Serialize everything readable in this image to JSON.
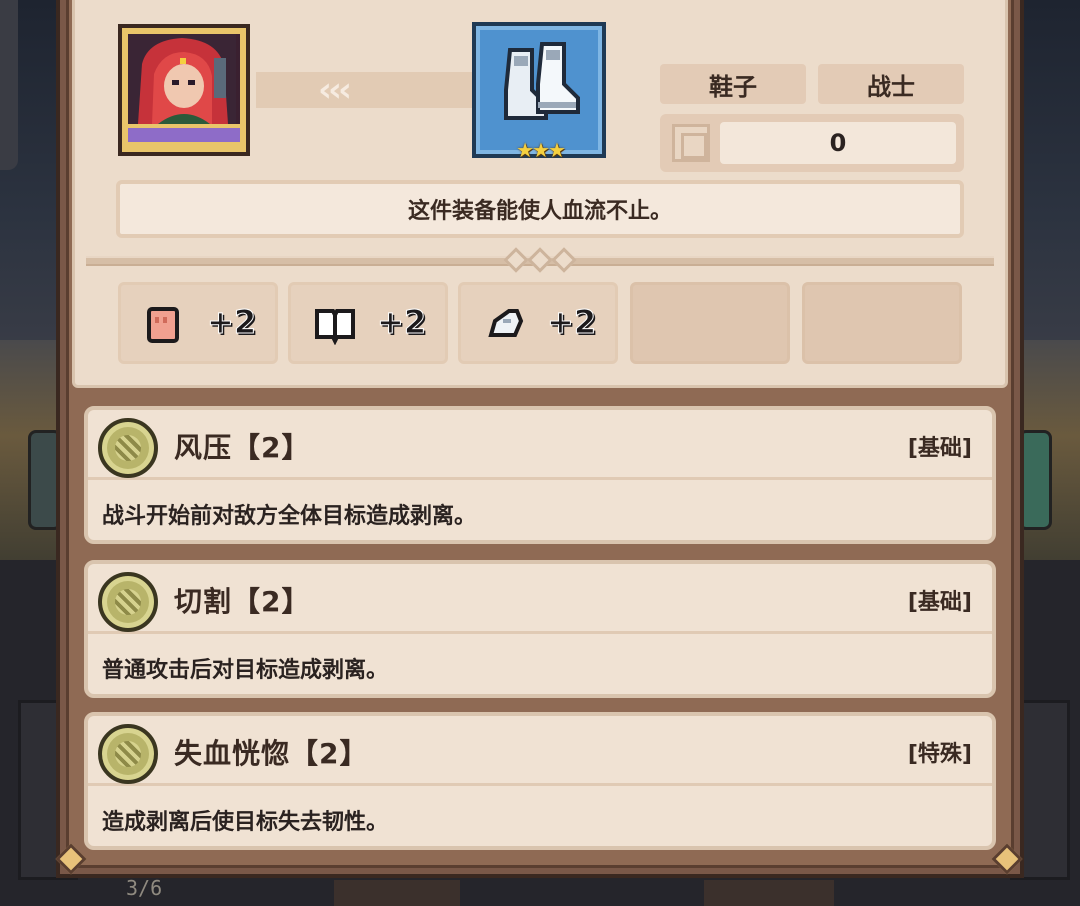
{
  "item": {
    "slot_tag": "鞋子",
    "class_tag": "战士",
    "value": "0",
    "stars": "★★★",
    "description": "这件装备能使人血流不止。",
    "stats": [
      {
        "icon": "fist-icon",
        "value": "+2"
      },
      {
        "icon": "book-icon",
        "value": "+2"
      },
      {
        "icon": "boot-icon",
        "value": "+2"
      }
    ]
  },
  "skills": [
    {
      "name": "风压【2】",
      "type": "[基础]",
      "description": "战斗开始前对敌方全体目标造成剥离。"
    },
    {
      "name": "切割【2】",
      "type": "[基础]",
      "description": "普通攻击后对目标造成剥离。"
    },
    {
      "name": "失血恍惚【2】",
      "type": "[特殊]",
      "description": "造成剥离后使目标失去韧性。"
    }
  ],
  "background": {
    "counter": "3/6"
  },
  "colors": {
    "panel_frame": "#8f6a54",
    "card_bg": "#ecdccb",
    "item_frame_blue": "#4f92cf",
    "skill_badge": "#b8b46a",
    "star": "#f4d040"
  }
}
